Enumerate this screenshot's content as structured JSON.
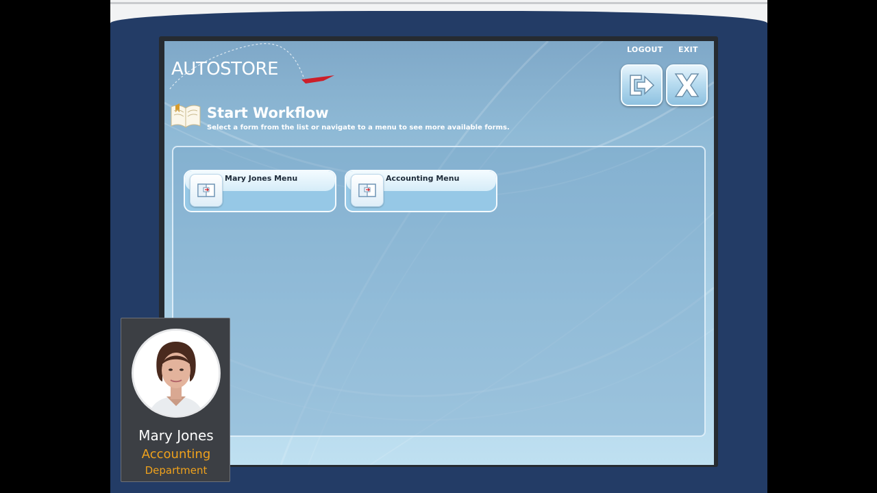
{
  "header": {
    "brand": "AUTOSTORE",
    "logout_label": "LOGOUT",
    "exit_label": "EXIT"
  },
  "workflow": {
    "title": "Start Workflow",
    "subtitle": "Select a form from the list or navigate to a menu to see more available forms."
  },
  "menus": [
    {
      "label": "Mary Jones Menu"
    },
    {
      "label": "Accounting Menu"
    }
  ],
  "user": {
    "name": "Mary Jones",
    "dept_line1": "Accounting",
    "dept_line2": "Department"
  },
  "colors": {
    "frame": "#233c66",
    "accent": "#f0a21c",
    "brand_arrow": "#cc1f2a"
  }
}
